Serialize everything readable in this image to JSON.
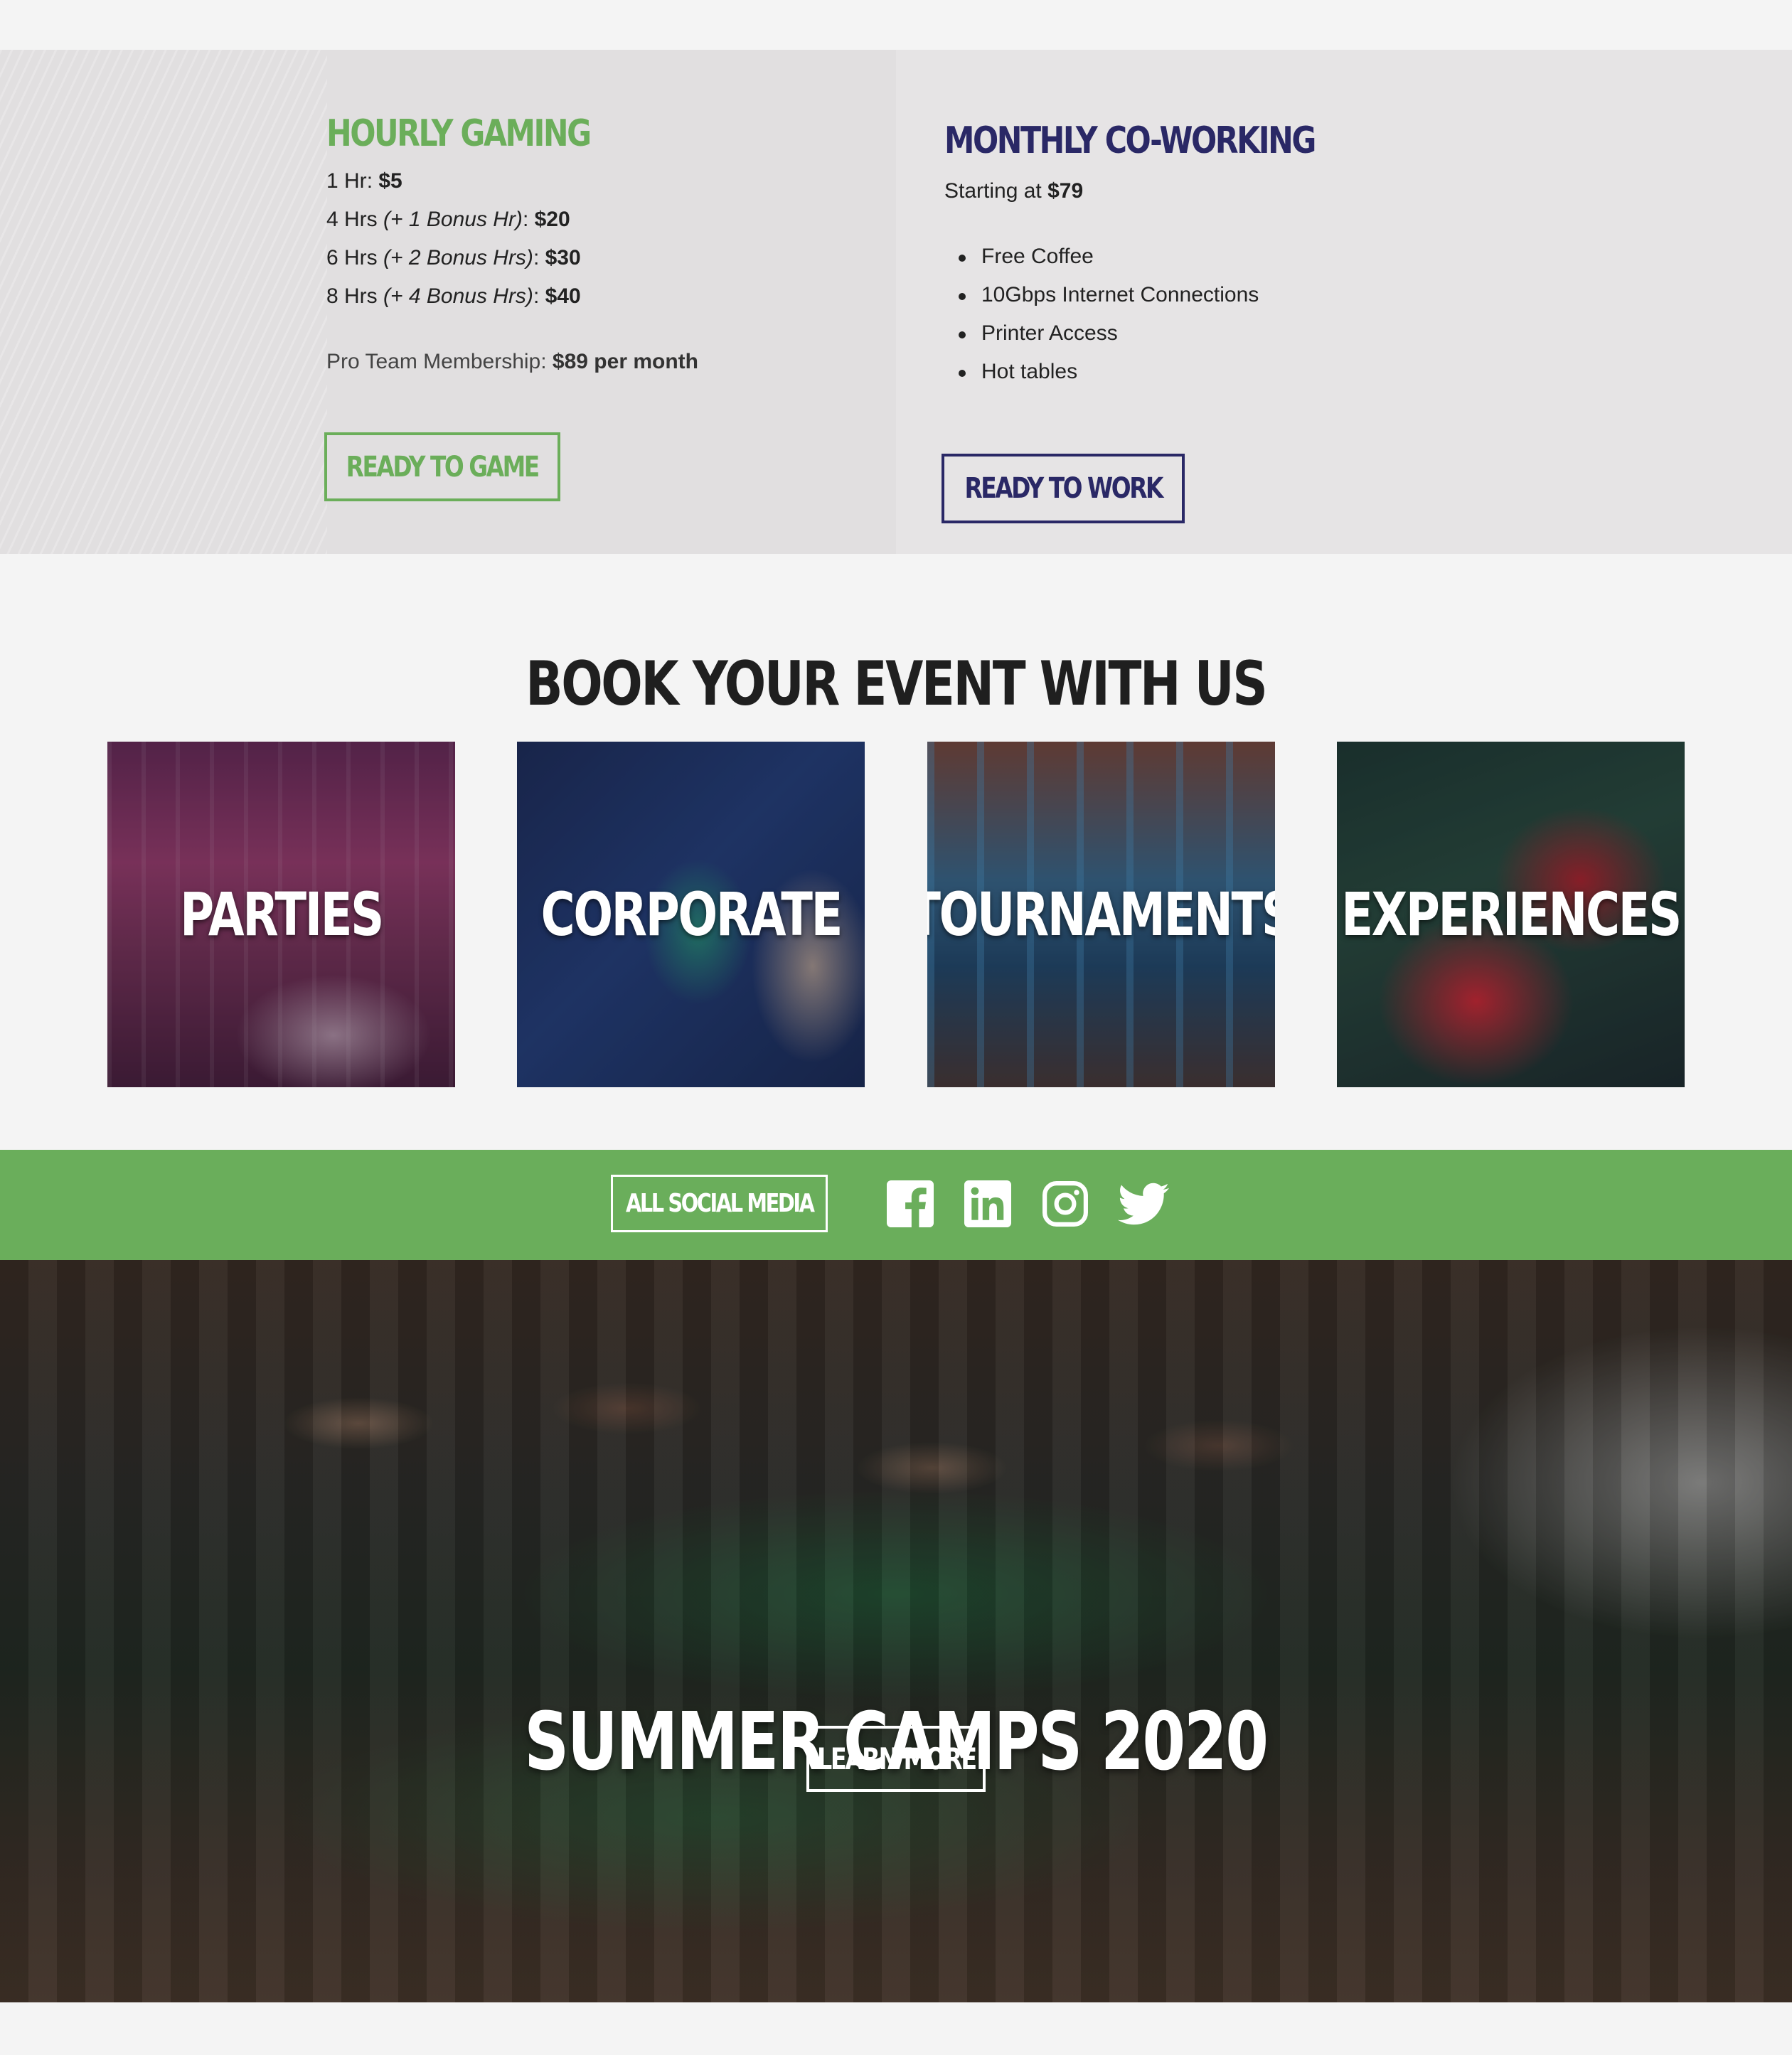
{
  "pricing": {
    "hourly": {
      "title": "HOURLY GAMING",
      "lines": [
        {
          "label": "1 Hr",
          "bonus": "",
          "price": "$5"
        },
        {
          "label": "4 Hrs ",
          "bonus": "(+ 1 Bonus Hr)",
          "price": "$20"
        },
        {
          "label": "6 Hrs ",
          "bonus": "(+ 2 Bonus Hrs)",
          "price": "$30"
        },
        {
          "label": "8 Hrs ",
          "bonus": "(+ 4 Bonus Hrs)",
          "price": "$40"
        }
      ],
      "membership_label": "Pro Team Membership:",
      "membership_price": "$89 per month",
      "button": "READY TO GAME"
    },
    "coworking": {
      "title": "MONTHLY CO-WORKING",
      "starting_label": "Starting at",
      "starting_price": "$79",
      "features": [
        "Free Coffee",
        "10Gbps Internet Connections",
        "Printer Access",
        "Hot tables"
      ],
      "button": "READY TO WORK"
    }
  },
  "events": {
    "title": "BOOK YOUR EVENT WITH US",
    "cards": [
      "PARTIES",
      "CORPORATE",
      "TOURNAMENTS",
      "EXPERIENCES"
    ]
  },
  "social": {
    "button": "ALL SOCIAL MEDIA",
    "icons": [
      "facebook-icon",
      "linkedin-icon",
      "instagram-icon",
      "twitter-icon"
    ]
  },
  "camp": {
    "title": "SUMMER CAMPS 2020",
    "button": "LEARN MORE"
  },
  "colors": {
    "green": "#6bae5a",
    "navy": "#2a2866",
    "social_bar": "#6aae5b"
  }
}
